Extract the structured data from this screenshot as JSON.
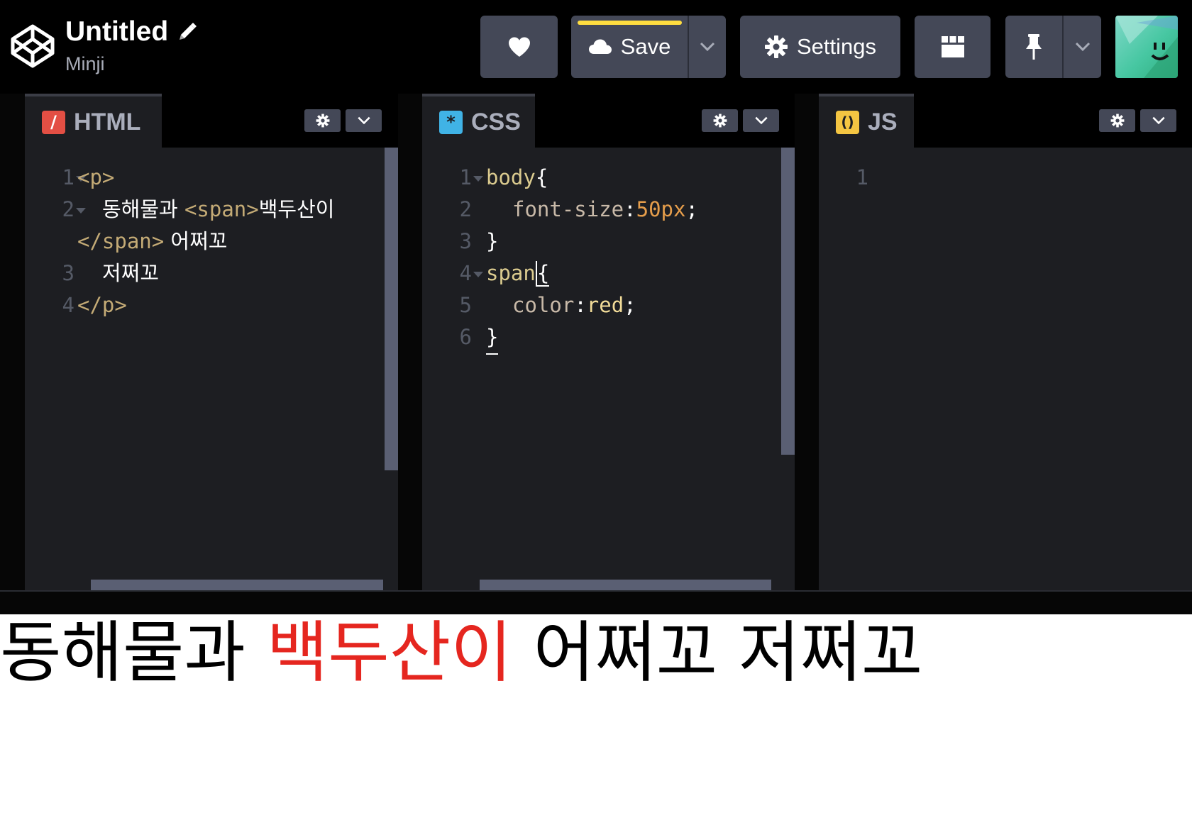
{
  "header": {
    "title": "Untitled",
    "user": "Minji",
    "save_label": "Save",
    "settings_label": "Settings",
    "icons": [
      "codepen-logo-icon",
      "pencil-icon",
      "heart-icon",
      "cloud-icon",
      "chevron-down-icon",
      "gear-icon",
      "layout-grid-icon",
      "pin-icon",
      "avatar"
    ],
    "save_accent": "#ffdd40"
  },
  "panes": {
    "html": {
      "name": "HTML",
      "icon_color": "#e34f44",
      "line_numbers": [
        "1",
        "2",
        "3",
        "4"
      ],
      "lines": {
        "l1": "<p>",
        "l2_text": "동해물과 ",
        "l2_tag": "<span>",
        "l2_inner": "백두산이",
        "l2b_tag": "</span>",
        "l2b_text": " 어쩌꼬",
        "l3_text": "저쩌꼬",
        "l4": "</p>"
      }
    },
    "css": {
      "name": "CSS",
      "icon_color": "#40b3e6",
      "line_numbers": [
        "1",
        "2",
        "3",
        "4",
        "5",
        "6"
      ],
      "lines": {
        "l1_sel": "body",
        "l1_brace": "{",
        "l2_prop": "font-size",
        "l2_colon": ":",
        "l2_val": "50px",
        "l2_semi": ";",
        "l3": "}",
        "l4_sel": "span",
        "l4_brace": "{",
        "l5_prop": "color",
        "l5_colon": ":",
        "l5_val": "red",
        "l5_semi": ";",
        "l6": "}"
      }
    },
    "js": {
      "name": "JS",
      "icon_color": "#f4c542",
      "line_numbers": [
        "1"
      ]
    }
  },
  "result": {
    "before": "동해물과 ",
    "span": "백두산이",
    "after": " 어쩌꼬 저쩌꼬",
    "span_color": "#e5261f"
  }
}
